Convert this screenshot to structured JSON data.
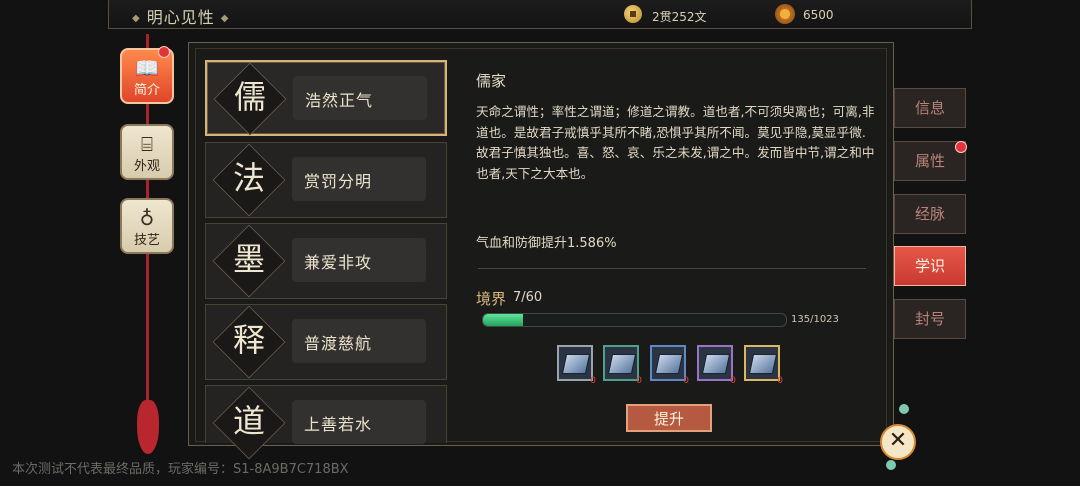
{
  "header": {
    "title": "明心见性",
    "money": "2贯252文",
    "jade": "6500",
    "icons": {
      "money": "coin-icon",
      "jade": "jade-icon"
    }
  },
  "left_nav": [
    {
      "label": "简介",
      "icon": "book-icon",
      "active": true,
      "badge": true
    },
    {
      "label": "外观",
      "icon": "robe-icon",
      "active": false
    },
    {
      "label": "技艺",
      "icon": "pipa-icon",
      "active": false
    }
  ],
  "schools": [
    {
      "char": "儒",
      "name": "浩然正气",
      "selected": true
    },
    {
      "char": "法",
      "name": "赏罚分明",
      "selected": false
    },
    {
      "char": "墨",
      "name": "兼爱非攻",
      "selected": false
    },
    {
      "char": "释",
      "name": "普渡慈航",
      "selected": false
    },
    {
      "char": "道",
      "name": "上善若水",
      "selected": false
    }
  ],
  "detail": {
    "title": "儒家",
    "text": "天命之谓性；率性之谓道；修道之谓教。道也者,不可须臾离也；可离,非道也。是故君子戒慎乎其所不睹,恐惧乎其所不闻。莫见乎隐,莫显乎微.故君子慎其独也。喜、怒、哀、乐之未发,谓之中。发而皆中节,谓之和中也者,天下之大本也。",
    "bonus": "气血和防御提升1.586%",
    "realm_label": "境界",
    "realm_value": "7/60",
    "progress_text": "135/1023",
    "progress": 0.132,
    "items": [
      {
        "border": "#9aa4ae",
        "count": "0"
      },
      {
        "border": "#4ea08a",
        "count": "0"
      },
      {
        "border": "#5d8ac6",
        "count": "0"
      },
      {
        "border": "#9a72c6",
        "count": "0"
      },
      {
        "border": "#d8b860",
        "count": "0"
      }
    ],
    "upgrade_label": "提升"
  },
  "right_tabs": [
    {
      "label": "信息",
      "active": false
    },
    {
      "label": "属性",
      "active": false,
      "badge": true
    },
    {
      "label": "经脉",
      "active": false
    },
    {
      "label": "学识",
      "active": true
    },
    {
      "label": "封号",
      "active": false
    }
  ],
  "close_icon": "close-icon",
  "watermark": "本次测试不代表最终品质，玩家编号：S1-8A9B7C718BX",
  "colors": {
    "accent": "#e3574a",
    "progress": "#3ccf7a",
    "gold": "#d6b47c"
  }
}
